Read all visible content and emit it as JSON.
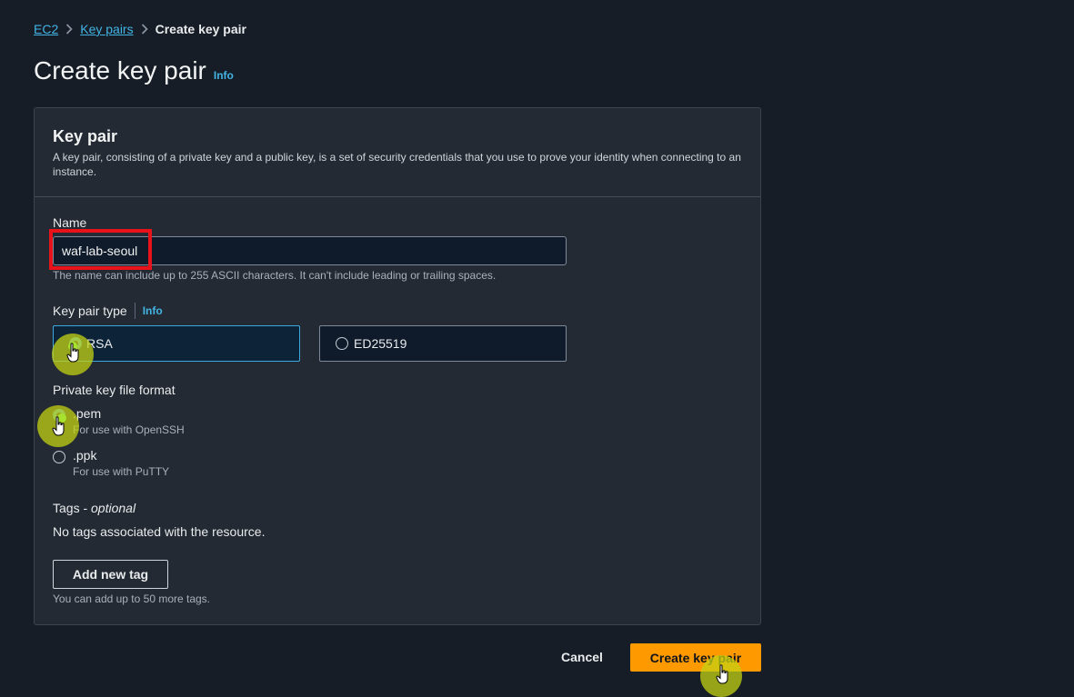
{
  "breadcrumb": {
    "items": [
      "EC2",
      "Key pairs"
    ],
    "current": "Create key pair"
  },
  "page": {
    "title": "Create key pair",
    "info_link": "Info"
  },
  "panel": {
    "title": "Key pair",
    "description": "A key pair, consisting of a private key and a public key, is a set of security credentials that you use to prove your identity when connecting to an instance."
  },
  "name_field": {
    "label": "Name",
    "value": "waf-lab-seoul",
    "hint": "The name can include up to 255 ASCII characters. It can't include leading or trailing spaces."
  },
  "key_pair_type": {
    "label": "Key pair type",
    "info_link": "Info",
    "options": [
      "RSA",
      "ED25519"
    ],
    "selected": "RSA"
  },
  "file_format": {
    "label": "Private key file format",
    "options": [
      {
        "label": ".pem",
        "description": "For use with OpenSSH"
      },
      {
        "label": ".ppk",
        "description": "For use with PuTTY"
      }
    ],
    "selected": ".pem"
  },
  "tags": {
    "label": "Tags - ",
    "label_optional": "optional",
    "empty_text": "No tags associated with the resource.",
    "add_button": "Add new tag",
    "hint": "You can add up to 50 more tags."
  },
  "actions": {
    "cancel": "Cancel",
    "create": "Create key pair"
  },
  "colors": {
    "background": "#161d26",
    "panel": "#232a33",
    "link": "#42b4e5",
    "primary_button": "#ff9900",
    "highlight_box": "#e8121b",
    "click_marker": "#c4d214"
  },
  "icons": [
    "chevron-right-icon",
    "pointer-hand-icon",
    "click-marker-icon"
  ]
}
